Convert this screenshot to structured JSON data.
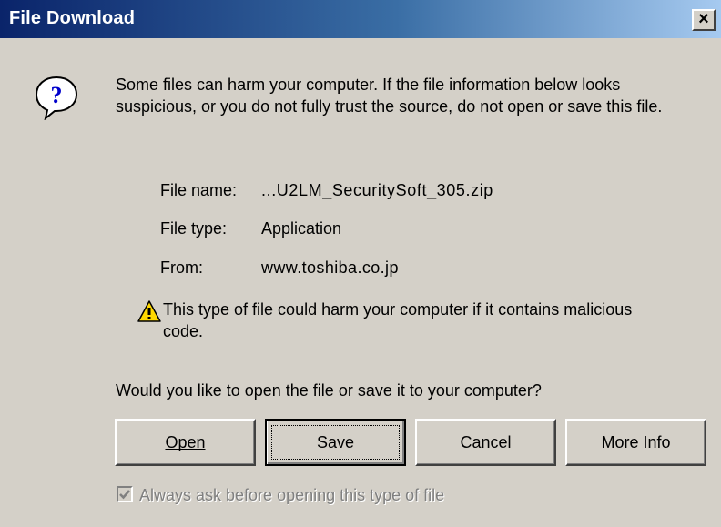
{
  "window": {
    "title": "File Download",
    "close_label": "×"
  },
  "intro": {
    "text": "Some files can harm your computer. If the file information below looks suspicious, or you do not fully trust the source, do not open or save this file.",
    "icon": "question-icon"
  },
  "file_info": {
    "name_label": "File name:",
    "name_value": "...U2LM_SecuritySoft_305.zip",
    "type_label": "File type:",
    "type_value": "Application",
    "from_label": "From:",
    "from_value": "www.toshiba.co.jp"
  },
  "warning": {
    "icon": "warning-icon",
    "text": "This type of file could harm your computer if it contains malicious code."
  },
  "prompt": {
    "text": "Would you like to open the file or save it to your computer?"
  },
  "buttons": {
    "open": "Open",
    "save": "Save",
    "cancel": "Cancel",
    "more_info": "More Info"
  },
  "always_ask": {
    "label": "Always ask before opening this type of file",
    "checked": true,
    "disabled": true
  },
  "colors": {
    "title_start": "#0a246a",
    "title_end": "#a6caf0",
    "face": "#d4d0c8",
    "disabled_text": "#808080"
  }
}
